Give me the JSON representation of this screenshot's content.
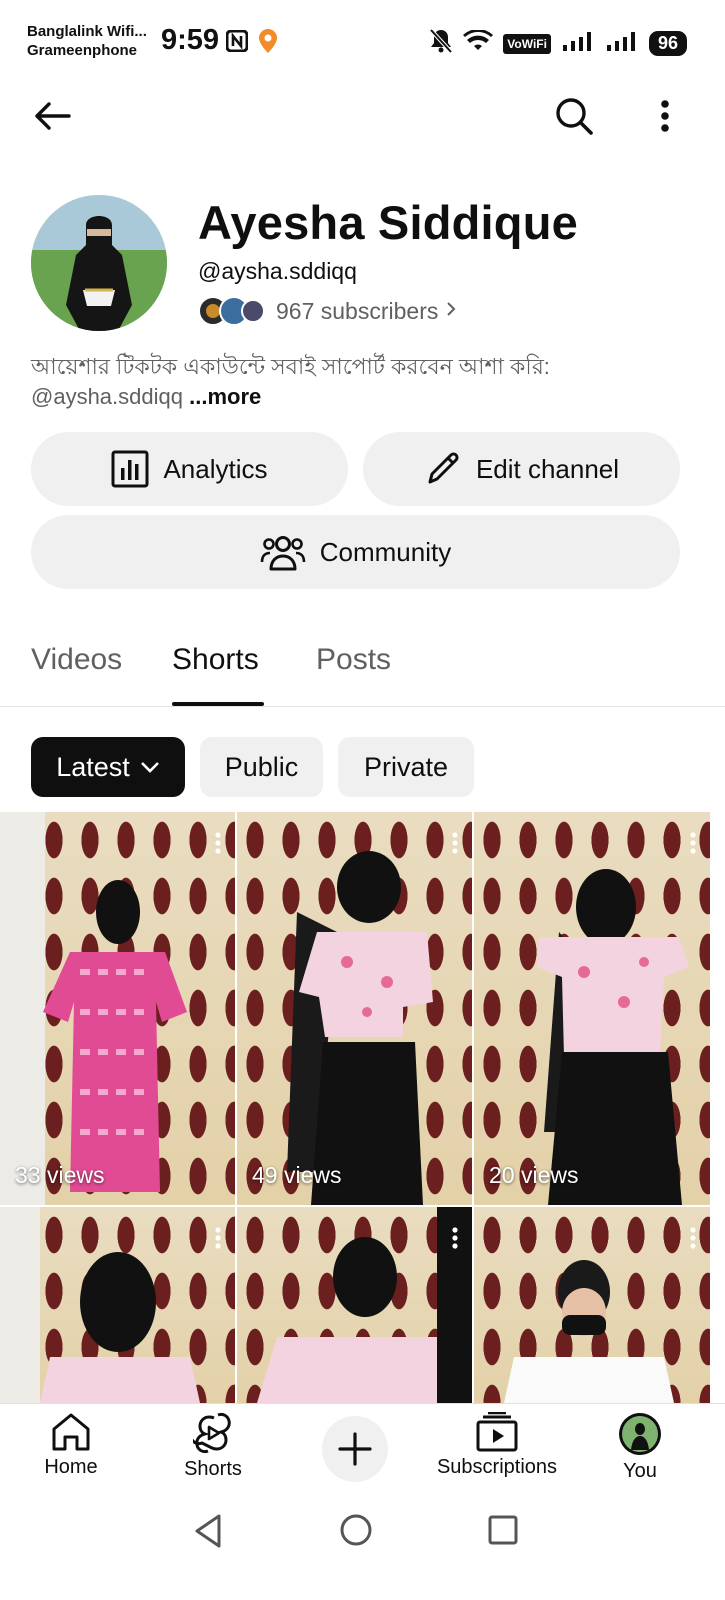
{
  "status_bar": {
    "carrier_1": "Banglalink Wifi...",
    "carrier_2": "Grameenphone",
    "time": "9:59",
    "nfc": "N",
    "vowifi": "VoWiFi",
    "battery": "96"
  },
  "channel": {
    "name": "Ayesha Siddique",
    "handle": "@aysha.sddiqq",
    "subscribers": "967 subscribers",
    "description_line1": "আয়েশার টিকটক একাউন্টে সবাই সাপোর্ট করবেন আশা করি:",
    "description_line2": "@aysha.sddiqq",
    "more": "...more"
  },
  "actions": {
    "analytics": "Analytics",
    "edit_channel": "Edit channel",
    "community": "Community"
  },
  "tabs": [
    {
      "label": "Videos"
    },
    {
      "label": "Shorts"
    },
    {
      "label": "Posts"
    }
  ],
  "chips": {
    "latest": "Latest",
    "public": "Public",
    "private": "Private"
  },
  "shorts": [
    {
      "views": "33 views"
    },
    {
      "views": "49 views"
    },
    {
      "views": "20 views"
    },
    {
      "views": ""
    },
    {
      "views": ""
    },
    {
      "views": ""
    }
  ],
  "bottom_nav": {
    "home": "Home",
    "shorts": "Shorts",
    "subscriptions": "Subscriptions",
    "you": "You"
  },
  "colors": {
    "text_primary": "#0f0f0f",
    "text_secondary": "#606060",
    "chip_bg": "#f0f0f0",
    "selected_chip": "#0f0f0f"
  }
}
